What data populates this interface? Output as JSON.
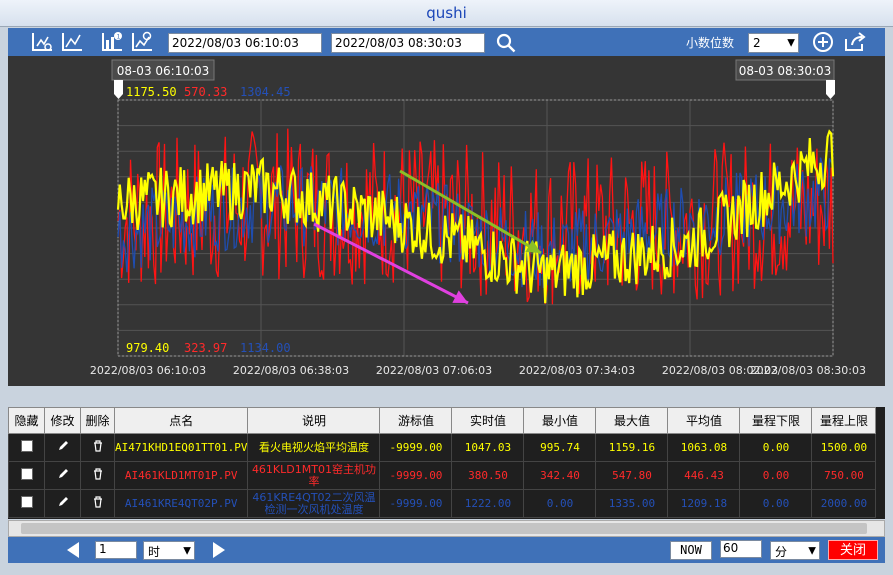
{
  "window": {
    "title": "qushi"
  },
  "toolbar": {
    "start_time": "2022/08/03 06:10:03",
    "end_time": "2022/08/03 08:30:03",
    "decimal_label": "小数位数",
    "decimal_value": "2",
    "icons": [
      "chart-settings-icon",
      "chart-scale-icon",
      "chart-info-icon",
      "chart-export-icon",
      "search-icon",
      "add-icon",
      "share-icon"
    ]
  },
  "chart": {
    "cursor_left_label": "08-03 06:10:03",
    "cursor_right_label": "08-03 08:30:03",
    "top_values": [
      "1175.50",
      "570.33",
      "1304.45"
    ],
    "bottom_values": [
      "979.40",
      "323.97",
      "1134.00"
    ],
    "x_ticks": [
      "2022/08/03 06:10:03",
      "2022/08/03 06:38:03",
      "2022/08/03 07:06:03",
      "2022/08/03 07:34:03",
      "2022/08/03 08:02:03",
      "2022/08/03 08:30:03"
    ],
    "colors": {
      "yellow": "#ffff00",
      "red": "#ff1414",
      "blue": "#1f4db0",
      "green_arrow": "#8cbf26",
      "magenta_arrow": "#e040e0"
    }
  },
  "chart_data": {
    "type": "line",
    "x": [
      "06:10:03",
      "06:38:03",
      "07:06:03",
      "07:34:03",
      "08:02:03",
      "08:30:03"
    ],
    "series": [
      {
        "values": [
          1100,
          1115,
          1080,
          1030,
          1060,
          1150
        ]
      },
      {
        "values": [
          460,
          480,
          470,
          445,
          455,
          480
        ]
      },
      {
        "values": [
          1220,
          1250,
          1240,
          1200,
          1230,
          1260
        ]
      }
    ],
    "grid": true
  },
  "table": {
    "headers": [
      "隐藏",
      "修改",
      "删除",
      "点名",
      "说明",
      "游标值",
      "实时值",
      "最小值",
      "最大值",
      "平均值",
      "量程下限",
      "量程上限"
    ],
    "rows": [
      {
        "color": "#ffff00",
        "name": "AI471KHD1EQ01TT01.PV",
        "desc": "看火电视火焰平均温度",
        "cursor": "-9999.00",
        "real": "1047.03",
        "min": "995.74",
        "max": "1159.16",
        "avg": "1063.08",
        "lo": "0.00",
        "hi": "1500.00"
      },
      {
        "color": "#ff2a2a",
        "name": "AI461KLD1MT01P.PV",
        "desc": "461KLD1MT01窑主机功率",
        "cursor": "-9999.00",
        "real": "380.50",
        "min": "342.40",
        "max": "547.80",
        "avg": "446.43",
        "lo": "0.00",
        "hi": "750.00"
      },
      {
        "color": "#2450b8",
        "name": "AI461KRE4QT02P.PV",
        "desc": "461KRE4QT02二次风温检测一次风机处温度",
        "cursor": "-9999.00",
        "real": "1222.00",
        "min": "0.00",
        "max": "1335.00",
        "avg": "1209.18",
        "lo": "0.00",
        "hi": "2000.00"
      }
    ]
  },
  "bottom": {
    "page_value": "1",
    "unit_value": "时",
    "now_label": "NOW",
    "span_value": "60",
    "span_unit": "分",
    "close_label": "关闭"
  }
}
